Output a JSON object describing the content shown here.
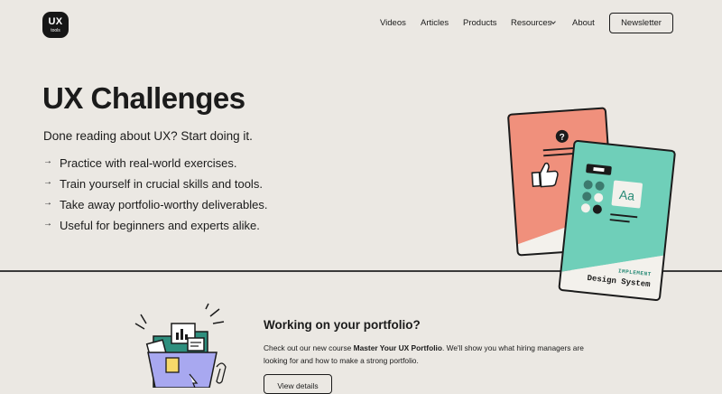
{
  "logo": {
    "line1": "UX",
    "line2": "tools"
  },
  "nav": {
    "items": [
      "Videos",
      "Articles",
      "Products",
      "Resources",
      "About"
    ],
    "newsletter": "Newsletter"
  },
  "hero": {
    "title": "UX Challenges",
    "subtitle": "Done reading about UX? Start doing it.",
    "features": [
      "Practice with real-world exercises.",
      "Train yourself in crucial skills and tools.",
      "Take away portfolio-worthy deliverables.",
      "Useful for beginners and experts alike."
    ],
    "arrow": "→",
    "card_back": {
      "icon": "question-mark",
      "glyph": "?",
      "color": "#f0907c"
    },
    "card_front": {
      "tag": "IMPLEMENT",
      "title": "Design System",
      "sample": "Aa",
      "color": "#6fcfb9"
    }
  },
  "promo": {
    "title": "Working on your portfolio?",
    "text_before": "Check out our new course ",
    "text_strong": "Master Your UX Portfolio",
    "text_after": ". We'll show you what hiring managers are looking for and how to make a strong portfolio.",
    "button": "View details",
    "folder_color": "#a8a8f0"
  }
}
